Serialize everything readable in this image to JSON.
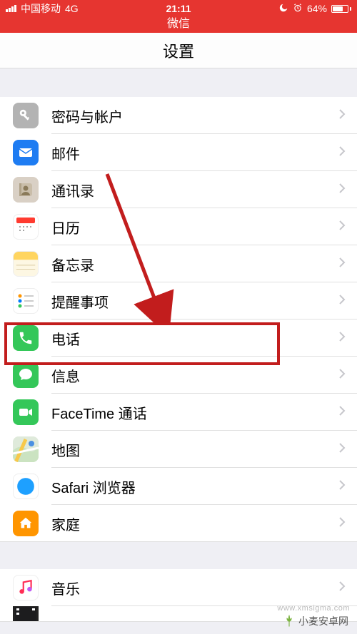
{
  "status": {
    "carrier": "中国移动",
    "network": "4G",
    "time": "21:11",
    "battery_pct": "64%",
    "moon_icon": "moon-icon",
    "alarm_icon": "alarm-icon"
  },
  "app_bar": {
    "title": "微信"
  },
  "header": {
    "title": "设置"
  },
  "rows": {
    "passwords": {
      "label": "密码与帐户"
    },
    "mail": {
      "label": "邮件"
    },
    "contacts": {
      "label": "通讯录"
    },
    "calendar": {
      "label": "日历"
    },
    "notes": {
      "label": "备忘录"
    },
    "reminders": {
      "label": "提醒事项"
    },
    "phone": {
      "label": "电话"
    },
    "messages": {
      "label": "信息"
    },
    "facetime": {
      "label": "FaceTime 通话"
    },
    "maps": {
      "label": "地图"
    },
    "safari": {
      "label": "Safari 浏览器"
    },
    "home": {
      "label": "家庭"
    },
    "music": {
      "label": "音乐"
    }
  },
  "watermark": {
    "text": "小麦安卓网",
    "url": "www.xmsigma.com"
  }
}
